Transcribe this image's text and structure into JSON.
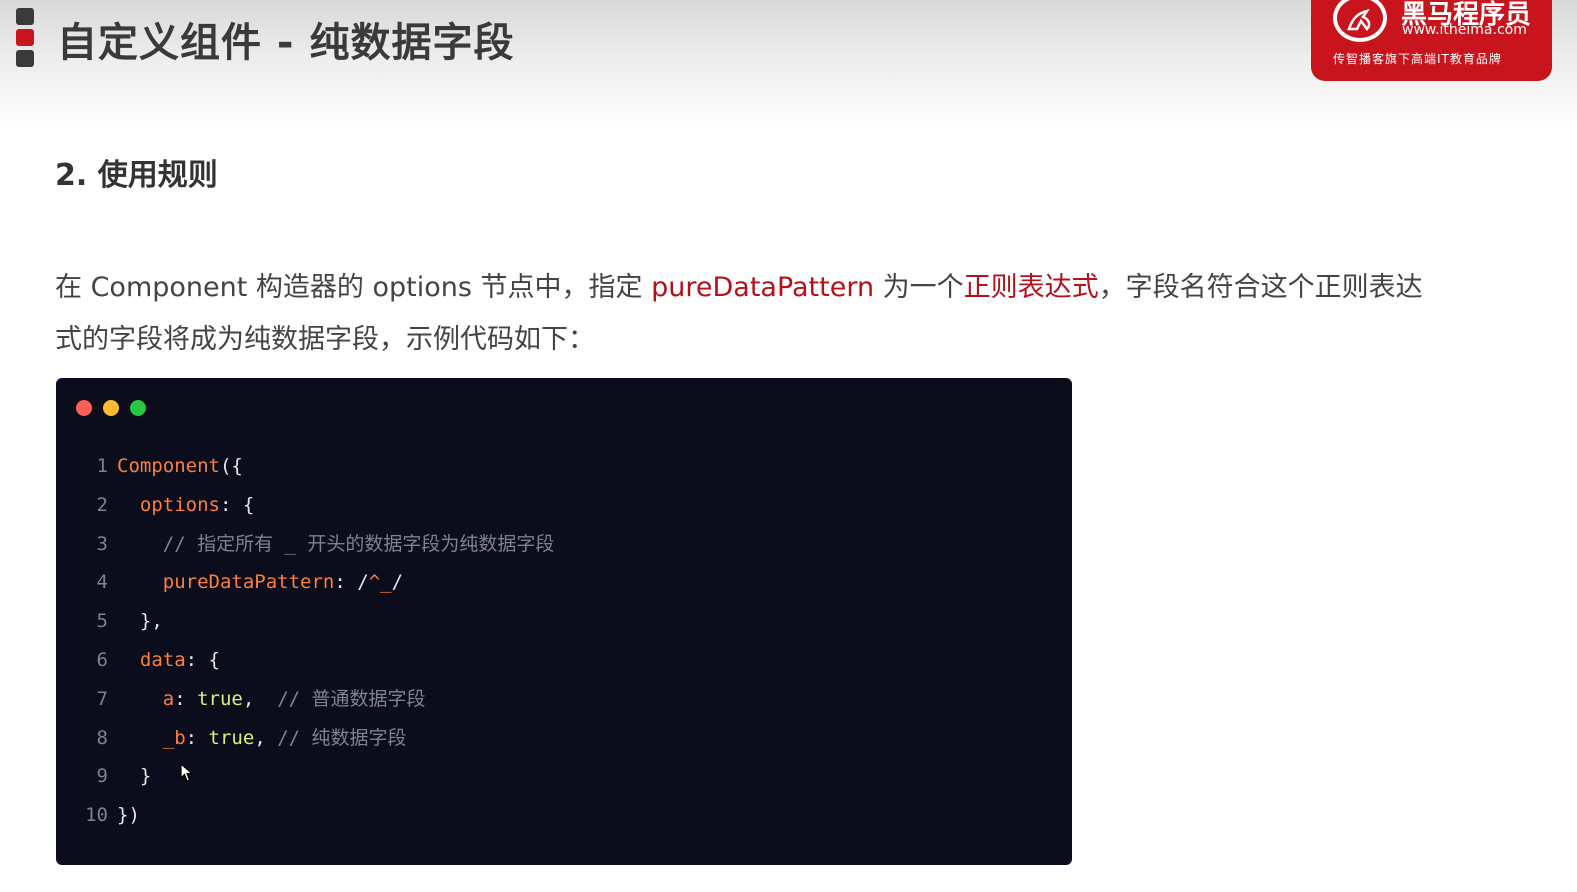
{
  "header": {
    "title": "自定义组件 - 纯数据字段",
    "mark_colors": [
      "#3a3a3a",
      "#c8151d",
      "#3a3a3a"
    ]
  },
  "logo": {
    "name": "黑马程序员",
    "url": "www.itheima.com",
    "slogan": "传智播客旗下高端IT教育品牌",
    "color": "#c8151d"
  },
  "section": {
    "title": "2. 使用规则"
  },
  "paragraph": {
    "part1": "在 Component 构造器的 options 节点中，指定 ",
    "highlight1": "pureDataPattern",
    "part2": " 为一个",
    "highlight2": "正则表达式",
    "part3": "，字段名符合这个正则表达式的字段将成为纯数据字段，示例代码如下："
  },
  "code_window": {
    "dot_colors": [
      "#fe5f57",
      "#febc2e",
      "#28c840"
    ],
    "lines": [
      {
        "number": "1",
        "tokens": [
          {
            "text": "Component",
            "kind": "fn"
          },
          {
            "text": "({",
            "kind": "p"
          }
        ]
      },
      {
        "number": "2",
        "tokens": [
          {
            "text": "  ",
            "kind": "p"
          },
          {
            "text": "options",
            "kind": "key"
          },
          {
            "text": ": {",
            "kind": "p"
          }
        ]
      },
      {
        "number": "3",
        "tokens": [
          {
            "text": "    ",
            "kind": "p"
          },
          {
            "text": "// 指定所有 _ 开头的数据字段为纯数据字段",
            "kind": "cm"
          }
        ]
      },
      {
        "number": "4",
        "tokens": [
          {
            "text": "    ",
            "kind": "p"
          },
          {
            "text": "pureDataPattern",
            "kind": "key"
          },
          {
            "text": ": /",
            "kind": "p"
          },
          {
            "text": "^_",
            "kind": "rx"
          },
          {
            "text": "/",
            "kind": "p"
          }
        ]
      },
      {
        "number": "5",
        "tokens": [
          {
            "text": "  },",
            "kind": "p"
          }
        ]
      },
      {
        "number": "6",
        "tokens": [
          {
            "text": "  ",
            "kind": "p"
          },
          {
            "text": "data",
            "kind": "key"
          },
          {
            "text": ": {",
            "kind": "p"
          }
        ]
      },
      {
        "number": "7",
        "tokens": [
          {
            "text": "    ",
            "kind": "p"
          },
          {
            "text": "a",
            "kind": "key"
          },
          {
            "text": ": ",
            "kind": "p"
          },
          {
            "text": "true",
            "kind": "kw"
          },
          {
            "text": ",  ",
            "kind": "p"
          },
          {
            "text": "// 普通数据字段",
            "kind": "cm"
          }
        ]
      },
      {
        "number": "8",
        "tokens": [
          {
            "text": "    ",
            "kind": "p"
          },
          {
            "text": "_b",
            "kind": "key"
          },
          {
            "text": ": ",
            "kind": "p"
          },
          {
            "text": "true",
            "kind": "kw"
          },
          {
            "text": ", ",
            "kind": "p"
          },
          {
            "text": "// 纯数据字段",
            "kind": "cm"
          }
        ]
      },
      {
        "number": "9",
        "tokens": [
          {
            "text": "  }",
            "kind": "p"
          }
        ]
      },
      {
        "number": "10",
        "tokens": [
          {
            "text": "})",
            "kind": "p"
          }
        ]
      }
    ]
  }
}
